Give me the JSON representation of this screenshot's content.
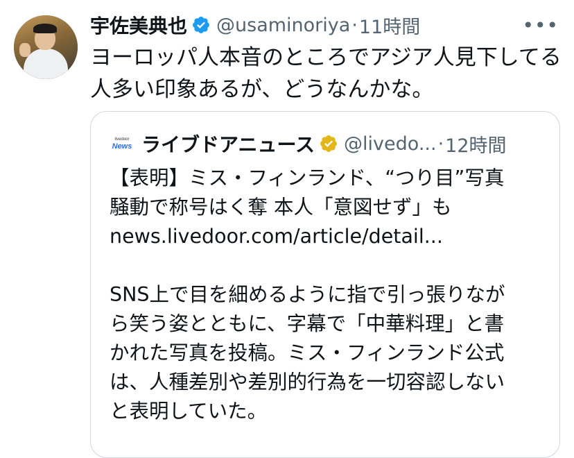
{
  "tweet": {
    "author_name": "宇佐美典也",
    "handle": "@usaminoriya",
    "separator": "·",
    "time": "11時間",
    "more_label": "•••",
    "text_line1": "ヨーロッパ人本音のところでアジア人見下してる",
    "text_line2": "人多い印象あるが、どうなんかな。"
  },
  "quote": {
    "logo_top": "livedoor",
    "logo_bottom": "News",
    "author_name": "ライブドアニュース",
    "handle": "@livedo...",
    "separator": "·",
    "time": "12時間",
    "body_line1": "【表明】ミス・フィンランド、“つり目”写真",
    "body_line2": "騒動で称号はく奪 本人「意図せず」も",
    "body_line3": "news.livedoor.com/article/detail...",
    "body_line4": "SNS上で目を細めるように指で引っ張りなが",
    "body_line5": "ら笑う姿とともに、字幕で「中華料理」と書",
    "body_line6": "かれた写真を投稿。ミス・フィンランド公式",
    "body_line7": "は、人種差別や差別的行為を一切容認しない",
    "body_line8": "と表明していた。"
  },
  "colors": {
    "text_primary": "#0f1419",
    "text_secondary": "#536471",
    "verified_blue": "#1d9bf0",
    "verified_gold": "#e2b719",
    "border": "#cfd9de"
  },
  "icons": {
    "author_verified": "verified-badge-blue-icon",
    "quote_verified": "verified-badge-gold-icon",
    "more": "more-dots-icon"
  }
}
